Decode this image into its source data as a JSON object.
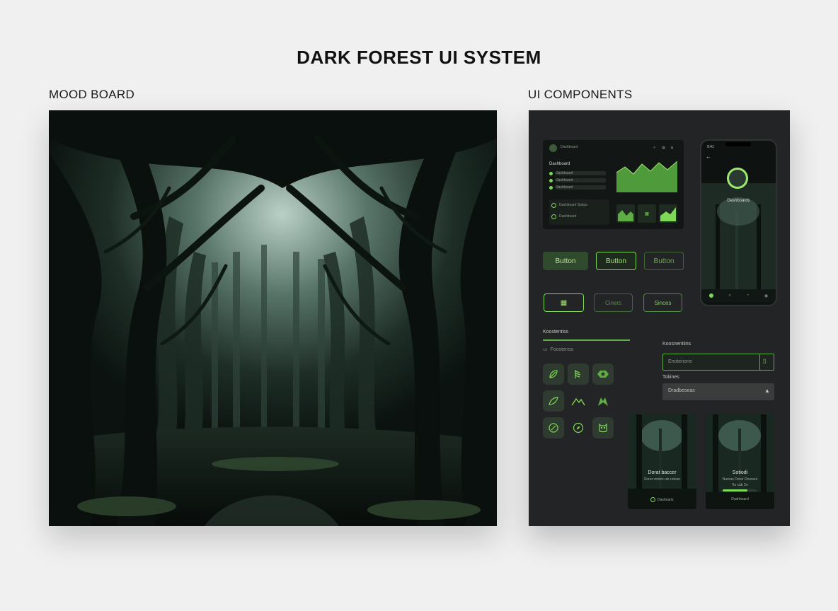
{
  "page": {
    "title": "DARK FOREST UI SYSTEM"
  },
  "sections": {
    "mood_board": "MOOD BOARD",
    "ui_components": "UI COMPONENTS"
  },
  "colors": {
    "accent": "#7ed957",
    "panel_bg": "#232425",
    "page_bg": "#f0f0f0",
    "forest_dark": "#0d1511",
    "forest_mist": "#9fb8ac"
  },
  "dashboard": {
    "header_title": "Dashboard",
    "section_title": "Dashboard",
    "list_items": [
      "Dashboard",
      "Dashboard",
      "Dashboard"
    ],
    "recent_items": [
      "Dashboard Status",
      "Dashboard"
    ],
    "icons": [
      "search-icon",
      "gear-icon",
      "close-icon"
    ]
  },
  "buttons": {
    "row1": [
      "Button",
      "Button",
      "Button"
    ],
    "row2_middle": "Ciners",
    "row2_right": "Sinces"
  },
  "nav": {
    "tab_label": "Koostentiss",
    "breadcrumb": "Foostenss"
  },
  "form": {
    "field1_label": "Koosnentiins",
    "field1_placeholder": "Enotenone",
    "field2_label": "Tokines",
    "field2_value": "Dradbeseas"
  },
  "phone": {
    "time": "9:41",
    "profile_name": "Dashboards",
    "nav_icons": [
      "home-icon",
      "search-icon",
      "bell-icon",
      "user-icon"
    ]
  },
  "cards": [
    {
      "title": "Dorat baccer",
      "subtitle": "Sorus mistrs uts rekoer",
      "footer": "Dashnaris"
    },
    {
      "title": "Sotiodi",
      "subtitle": "Nurous Dorer Dnowen",
      "progress_text": "6o cub 3n",
      "progress": 0.72,
      "footer": "Dashboard"
    }
  ],
  "icon_grid": [
    "leaf-icon",
    "fern-icon",
    "leaf-badge-icon",
    "leaf-outline-icon",
    "mountain-icon",
    "wolf-icon",
    "leaf-circle-icon",
    "compass-icon",
    "owl-icon"
  ]
}
